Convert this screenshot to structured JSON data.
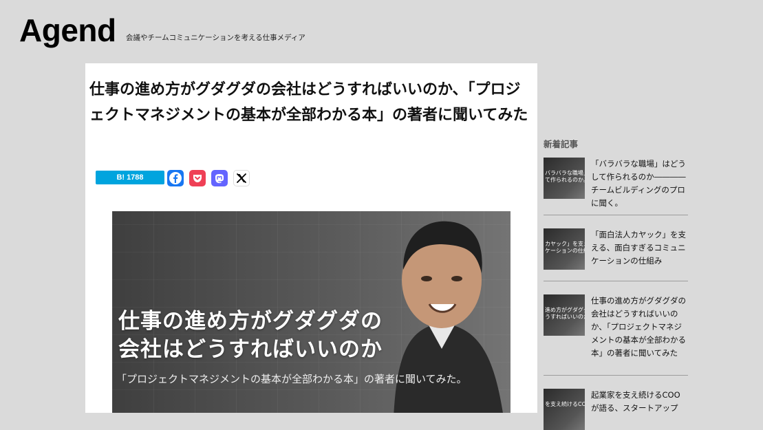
{
  "site": {
    "logo": "Agend",
    "tagline": "会議やチームコミュニケーションを考える仕事メディア"
  },
  "article": {
    "title": "仕事の進め方がグダグダの会社はどうすればいいのか、「プロジェクトマネジメントの基本が全部わかる本」の著者に聞いてみた",
    "share": {
      "hatena_label": "B!",
      "hatena_count": "1788",
      "buttons": [
        "facebook-icon",
        "pocket-icon",
        "mastodon-icon",
        "x-icon"
      ]
    },
    "hero": {
      "line1": "仕事の進め方がグダグダの",
      "line2": "会社はどうすればいいのか",
      "subtitle": "「プロジェクトマネジメントの基本が全部わかる本」の著者に聞いてみた。"
    }
  },
  "sidebar": {
    "heading": "新着記事",
    "items": [
      {
        "title": "「バラバラな職場」はどうして作られるのか――――チームビルディングのプロに聞く。",
        "thumb_text": "バラバラな職場」は\nて作られるのか。"
      },
      {
        "title": "「面白法人カヤック」を支える、面白すぎるコミュニケーションの仕組み",
        "thumb_text": "カヤック」を支える\nケーションの仕組"
      },
      {
        "title": "仕事の進め方がグダグダの会社はどうすればいいのか、「プロジェクトマネジメントの基本が全部わかる本」の著者に聞いてみた",
        "thumb_text": "進め方がグダグダ\nうすればいいのか"
      },
      {
        "title": "起業家を支え続けるCOOが語る、スタートアップ",
        "thumb_text": "を支え続けるCOO"
      }
    ]
  },
  "colors": {
    "background": "#dadada",
    "hatena": "#00a4de",
    "facebook": "#1877f2",
    "pocket": "#ef4056",
    "mastodon": "#6364ff",
    "x": "#000000"
  }
}
